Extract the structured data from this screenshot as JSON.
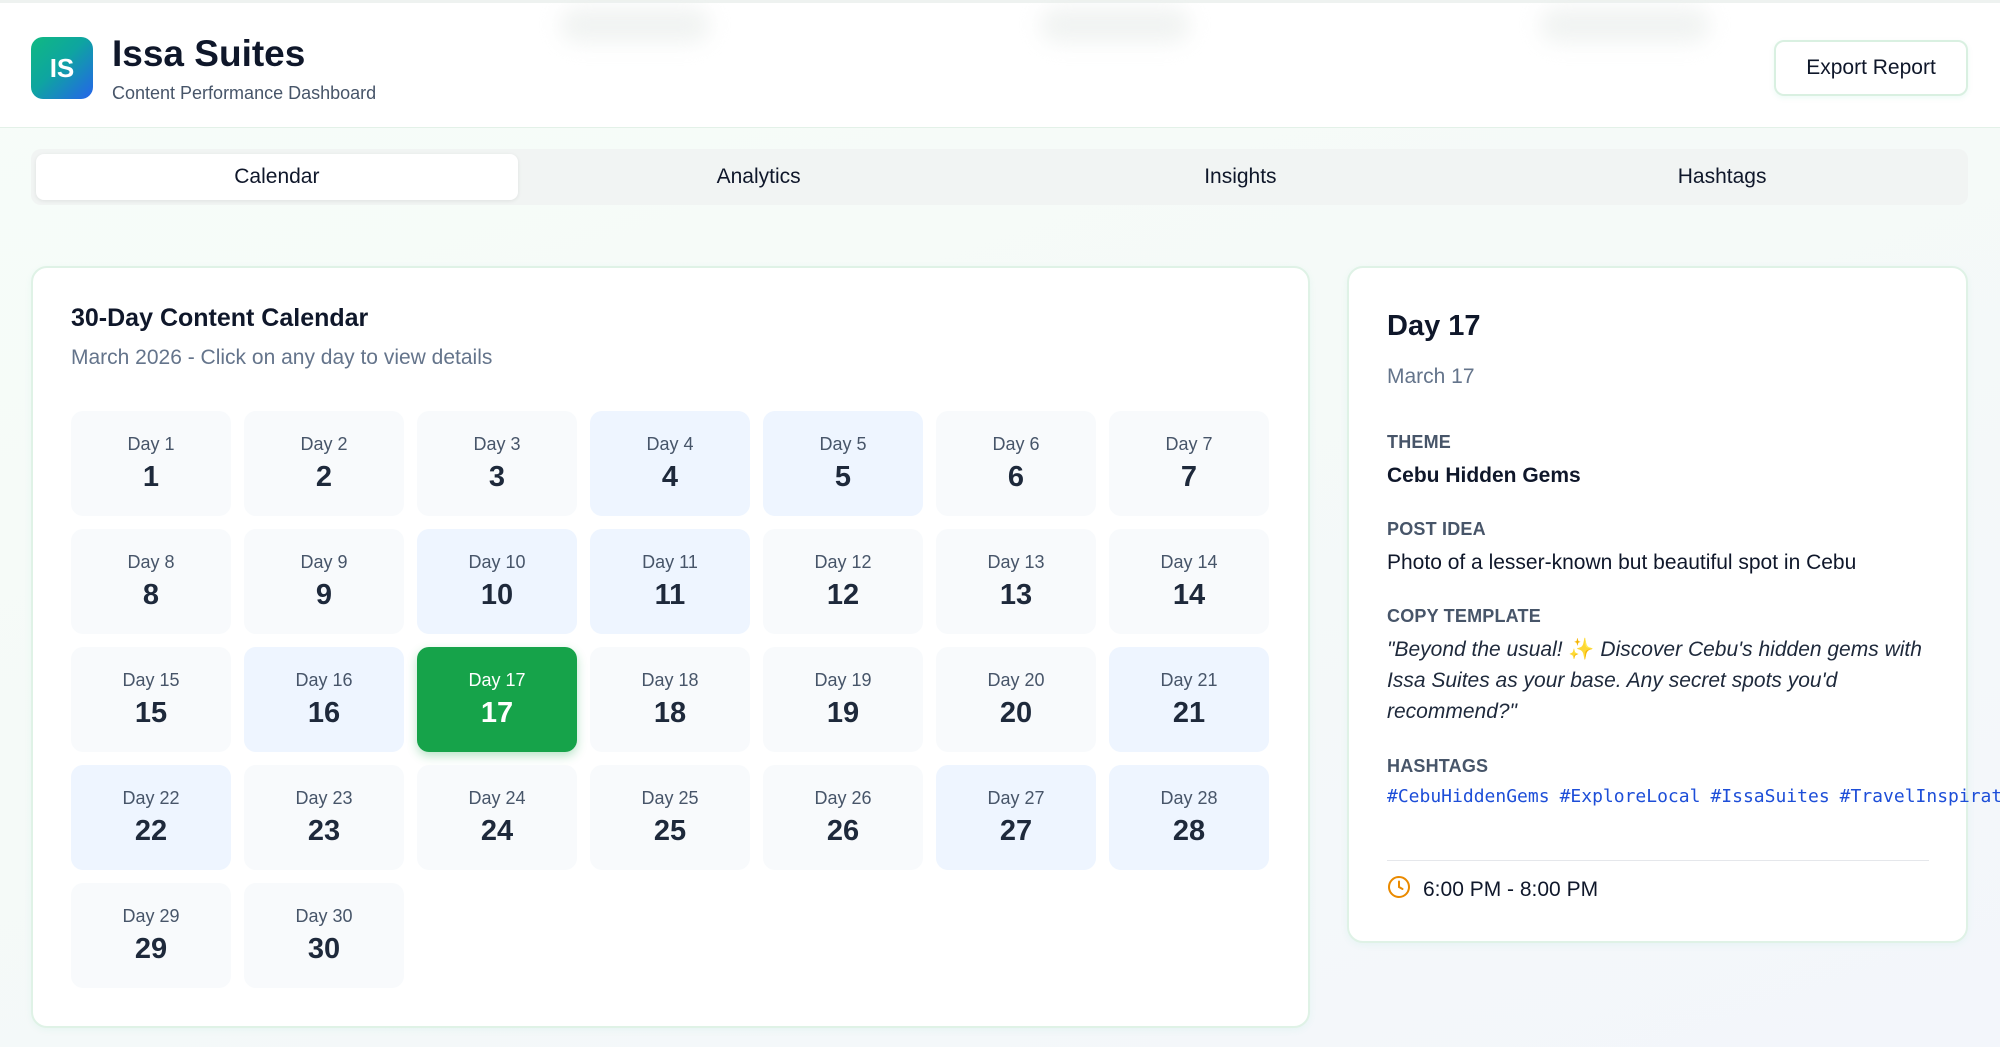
{
  "app": {
    "logo_initials": "IS",
    "title": "Issa Suites",
    "subtitle": "Content Performance Dashboard",
    "export_label": "Export Report"
  },
  "tabs": [
    {
      "label": "Calendar",
      "active": true
    },
    {
      "label": "Analytics",
      "active": false
    },
    {
      "label": "Insights",
      "active": false
    },
    {
      "label": "Hashtags",
      "active": false
    }
  ],
  "calendar": {
    "title": "30-Day Content Calendar",
    "subtitle": "March 2026 - Click on any day to view details",
    "days": [
      {
        "label": "Day 1",
        "num": "1",
        "style": "plain"
      },
      {
        "label": "Day 2",
        "num": "2",
        "style": "plain"
      },
      {
        "label": "Day 3",
        "num": "3",
        "style": "plain"
      },
      {
        "label": "Day 4",
        "num": "4",
        "style": "blue"
      },
      {
        "label": "Day 5",
        "num": "5",
        "style": "blue"
      },
      {
        "label": "Day 6",
        "num": "6",
        "style": "plain"
      },
      {
        "label": "Day 7",
        "num": "7",
        "style": "plain"
      },
      {
        "label": "Day 8",
        "num": "8",
        "style": "plain"
      },
      {
        "label": "Day 9",
        "num": "9",
        "style": "plain"
      },
      {
        "label": "Day 10",
        "num": "10",
        "style": "blue"
      },
      {
        "label": "Day 11",
        "num": "11",
        "style": "blue"
      },
      {
        "label": "Day 12",
        "num": "12",
        "style": "plain"
      },
      {
        "label": "Day 13",
        "num": "13",
        "style": "plain"
      },
      {
        "label": "Day 14",
        "num": "14",
        "style": "plain"
      },
      {
        "label": "Day 15",
        "num": "15",
        "style": "plain"
      },
      {
        "label": "Day 16",
        "num": "16",
        "style": "blue"
      },
      {
        "label": "Day 17",
        "num": "17",
        "style": "selected"
      },
      {
        "label": "Day 18",
        "num": "18",
        "style": "plain"
      },
      {
        "label": "Day 19",
        "num": "19",
        "style": "plain"
      },
      {
        "label": "Day 20",
        "num": "20",
        "style": "plain"
      },
      {
        "label": "Day 21",
        "num": "21",
        "style": "blue"
      },
      {
        "label": "Day 22",
        "num": "22",
        "style": "blue"
      },
      {
        "label": "Day 23",
        "num": "23",
        "style": "plain"
      },
      {
        "label": "Day 24",
        "num": "24",
        "style": "plain"
      },
      {
        "label": "Day 25",
        "num": "25",
        "style": "plain"
      },
      {
        "label": "Day 26",
        "num": "26",
        "style": "plain"
      },
      {
        "label": "Day 27",
        "num": "27",
        "style": "blue"
      },
      {
        "label": "Day 28",
        "num": "28",
        "style": "blue"
      },
      {
        "label": "Day 29",
        "num": "29",
        "style": "plain"
      },
      {
        "label": "Day 30",
        "num": "30",
        "style": "plain"
      }
    ]
  },
  "detail": {
    "title": "Day 17",
    "date": "March 17",
    "theme_label": "THEME",
    "theme": "Cebu Hidden Gems",
    "post_idea_label": "POST IDEA",
    "post_idea": "Photo of a lesser-known but beautiful spot in Cebu",
    "copy_label": "COPY TEMPLATE",
    "copy_before": "\"Beyond the usual!",
    "copy_emoji": "✨",
    "copy_after": "Discover Cebu's hidden gems with Issa Suites as your base. Any secret spots you'd recommend?\"",
    "hashtags_label": "HASHTAGS",
    "hashtags": [
      "#CebuHiddenGems",
      "#ExploreLocal",
      "#IssaSuites",
      "#TravelInspiration"
    ],
    "time": "6:00 PM - 8:00 PM",
    "time_icon": "clock-icon"
  },
  "colors": {
    "accent": "#16a34a",
    "highlight_day": "#eef5ff",
    "hashtag": "#1d4ed8",
    "clock": "#ea8a00"
  }
}
